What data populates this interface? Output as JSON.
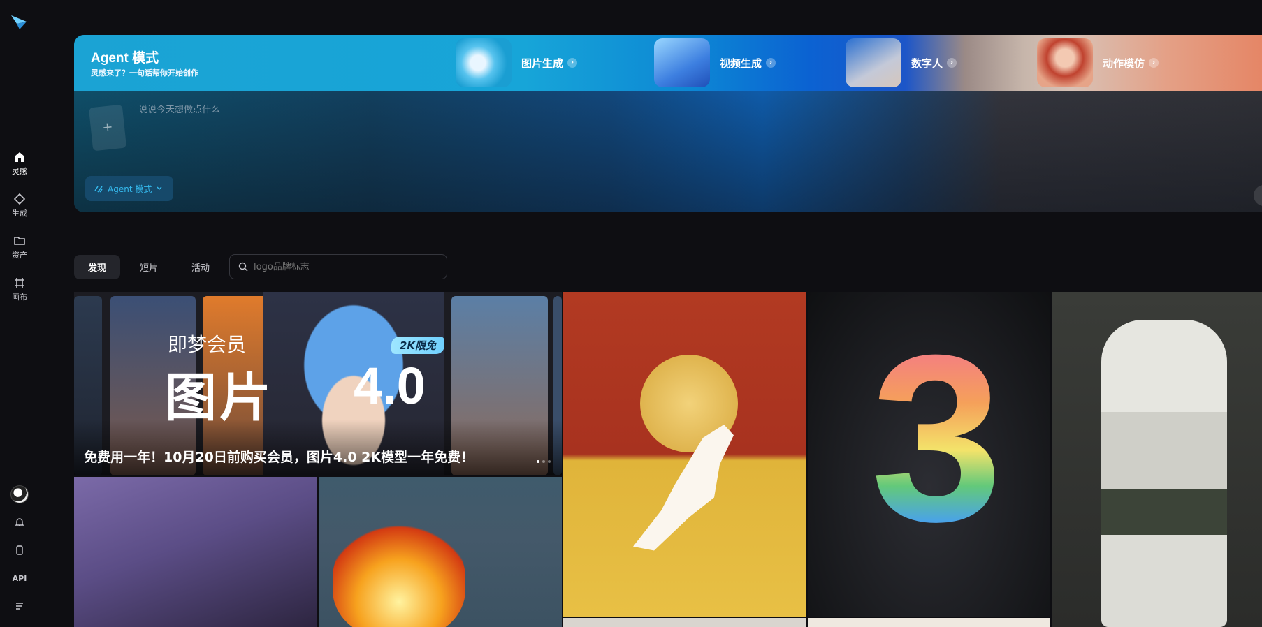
{
  "sidebar": {
    "nav": [
      {
        "label": "灵感",
        "icon": "home-icon",
        "active": true
      },
      {
        "label": "生成",
        "icon": "diamond-icon",
        "active": false
      },
      {
        "label": "资产",
        "icon": "folder-icon",
        "active": false
      },
      {
        "label": "画布",
        "icon": "canvas-grid-icon",
        "active": false
      }
    ],
    "bottom": {
      "api_label": "API"
    }
  },
  "hero": {
    "title": "Agent 模式",
    "subtitle": "灵感来了？一句话帮你开始创作",
    "modes": [
      {
        "label": "图片生成",
        "icon": "chevron-right-icon"
      },
      {
        "label": "视频生成",
        "icon": "chevron-right-icon"
      },
      {
        "label": "数字人",
        "icon": "chevron-right-icon"
      },
      {
        "label": "动作模仿",
        "icon": "chevron-right-icon"
      }
    ],
    "prompt_placeholder": "说说今天想做点什么",
    "agent_pill": "Agent 模式"
  },
  "tabs": [
    {
      "label": "发现",
      "active": true
    },
    {
      "label": "短片",
      "active": false
    },
    {
      "label": "活动",
      "active": false
    }
  ],
  "search": {
    "placeholder": "logo品牌标志"
  },
  "banner": {
    "member": "即梦会员",
    "big": "图片",
    "version": "4.0",
    "badge": "2K限免",
    "caption": "免费用一年！10月20日前购买会员，图片4.0 2K模型一年免费！"
  },
  "colors": {
    "accent": "#34b8ec",
    "background": "#0e0e12"
  }
}
